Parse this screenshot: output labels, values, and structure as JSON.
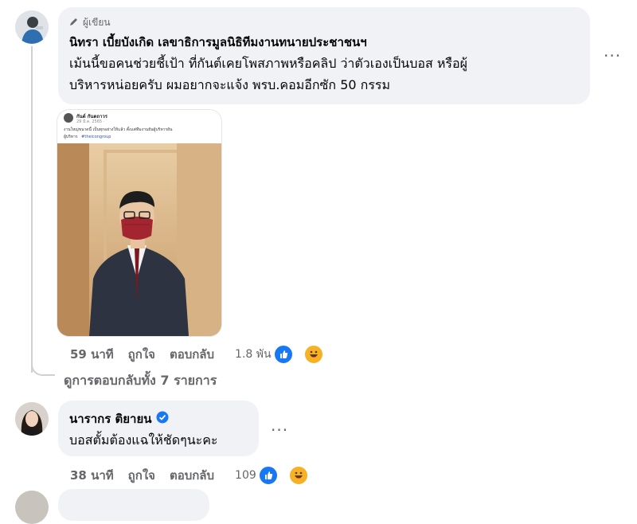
{
  "comment1": {
    "badge": "ผู้เขียน",
    "author": "นิทรา เบี้ยบังเกิด เลขาธิการมูลนิธิทีมงานทนายประชาชนฯ",
    "text_line1": "เม้นนี้ขอคนช่วยชี้เป้า ที่กันต์เคยโพสภาพหรือคลิป ว่าตัวเองเป็นบอส หรือผู้",
    "text_line2": "บริหารหน่อยครับ ผมอยากจะแจ้ง พรบ.คอมอีกซัก 50 กรรม",
    "time": "59 นาที",
    "like": "ถูกใจ",
    "reply": "ตอบกลับ",
    "reaction_count": "1.8 พัน",
    "more": "···",
    "image": {
      "post_author": "กันต์ กันตถาวร",
      "post_meta": "29 มี.ค. 2565 · ",
      "post_text": "งานใหญ่ขนาดนี้ เป็นทุกอย่างให้แล้ว ตั้งแต่ทีมงานยันผู้บริหารยัน",
      "post_text2": "ผู้บริหาร",
      "post_tag": "#theicongroup"
    }
  },
  "view_replies": "ดูการตอบกลับทั้ง 7 รายการ",
  "comment2": {
    "author": "นารากร ติยายน",
    "text": "บอสตั้มต้องแฉให้ชัดๆนะคะ",
    "time": "38 นาที",
    "like": "ถูกใจ",
    "reply": "ตอบกลับ",
    "reaction_count": "109",
    "more": "···"
  },
  "colors": {
    "bubble": "#f0f2f5",
    "meta": "#65676b",
    "like_blue": "#1877f2",
    "haha_yellow": "#f7b125",
    "verified": "#1877f2"
  }
}
